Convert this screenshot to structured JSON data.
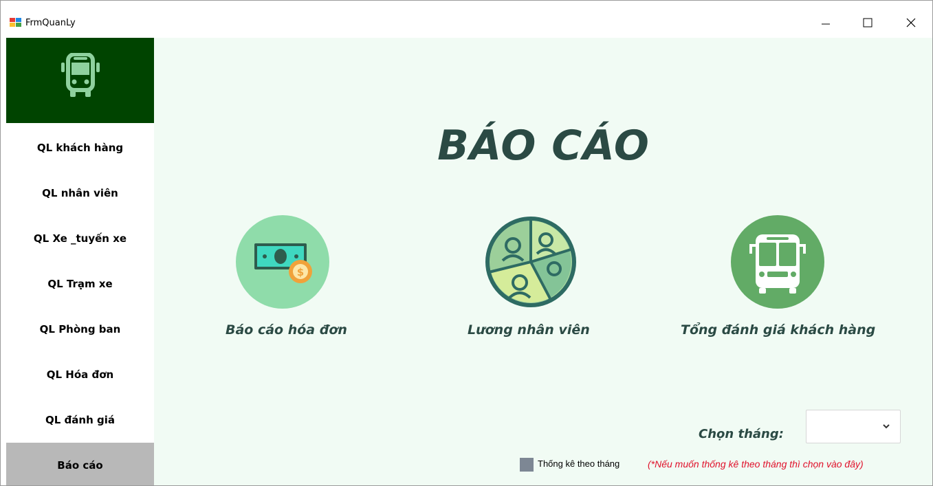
{
  "window": {
    "title": "FrmQuanLy",
    "controls": [
      "minimize-icon",
      "maximize-icon",
      "close-icon"
    ]
  },
  "sidebar": {
    "logo_icon": "bus-icon",
    "items": [
      {
        "label": "QL khách hàng",
        "active": false
      },
      {
        "label": "QL nhân viên",
        "active": false
      },
      {
        "label": "QL Xe _tuyến xe",
        "active": false
      },
      {
        "label": "QL Trạm xe",
        "active": false
      },
      {
        "label": "QL Phòng ban",
        "active": false
      },
      {
        "label": "QL Hóa đơn",
        "active": false
      },
      {
        "label": "QL đánh giá",
        "active": false
      },
      {
        "label": "Báo cáo",
        "active": true
      }
    ]
  },
  "main": {
    "title": "BÁO CÁO",
    "reports": [
      {
        "label": "Báo cáo hóa đơn",
        "icon": "money-icon"
      },
      {
        "label": "Lương nhân viên",
        "icon": "employees-icon"
      },
      {
        "label": "Tổng đánh giá khách hàng",
        "icon": "bus-front-icon"
      }
    ],
    "month_label": "Chọn tháng:",
    "month_value": "",
    "checkbox_label": "Thống kê theo tháng",
    "hint": "(*Nếu muốn thống kê theo tháng thì chọn vào đây)"
  },
  "colors": {
    "sidebar_header": "#004400",
    "main_bg": "#f1fbf4",
    "title_text": "#2b4a44",
    "active_item": "#b8b8b8",
    "hint_text": "#e0102a"
  }
}
